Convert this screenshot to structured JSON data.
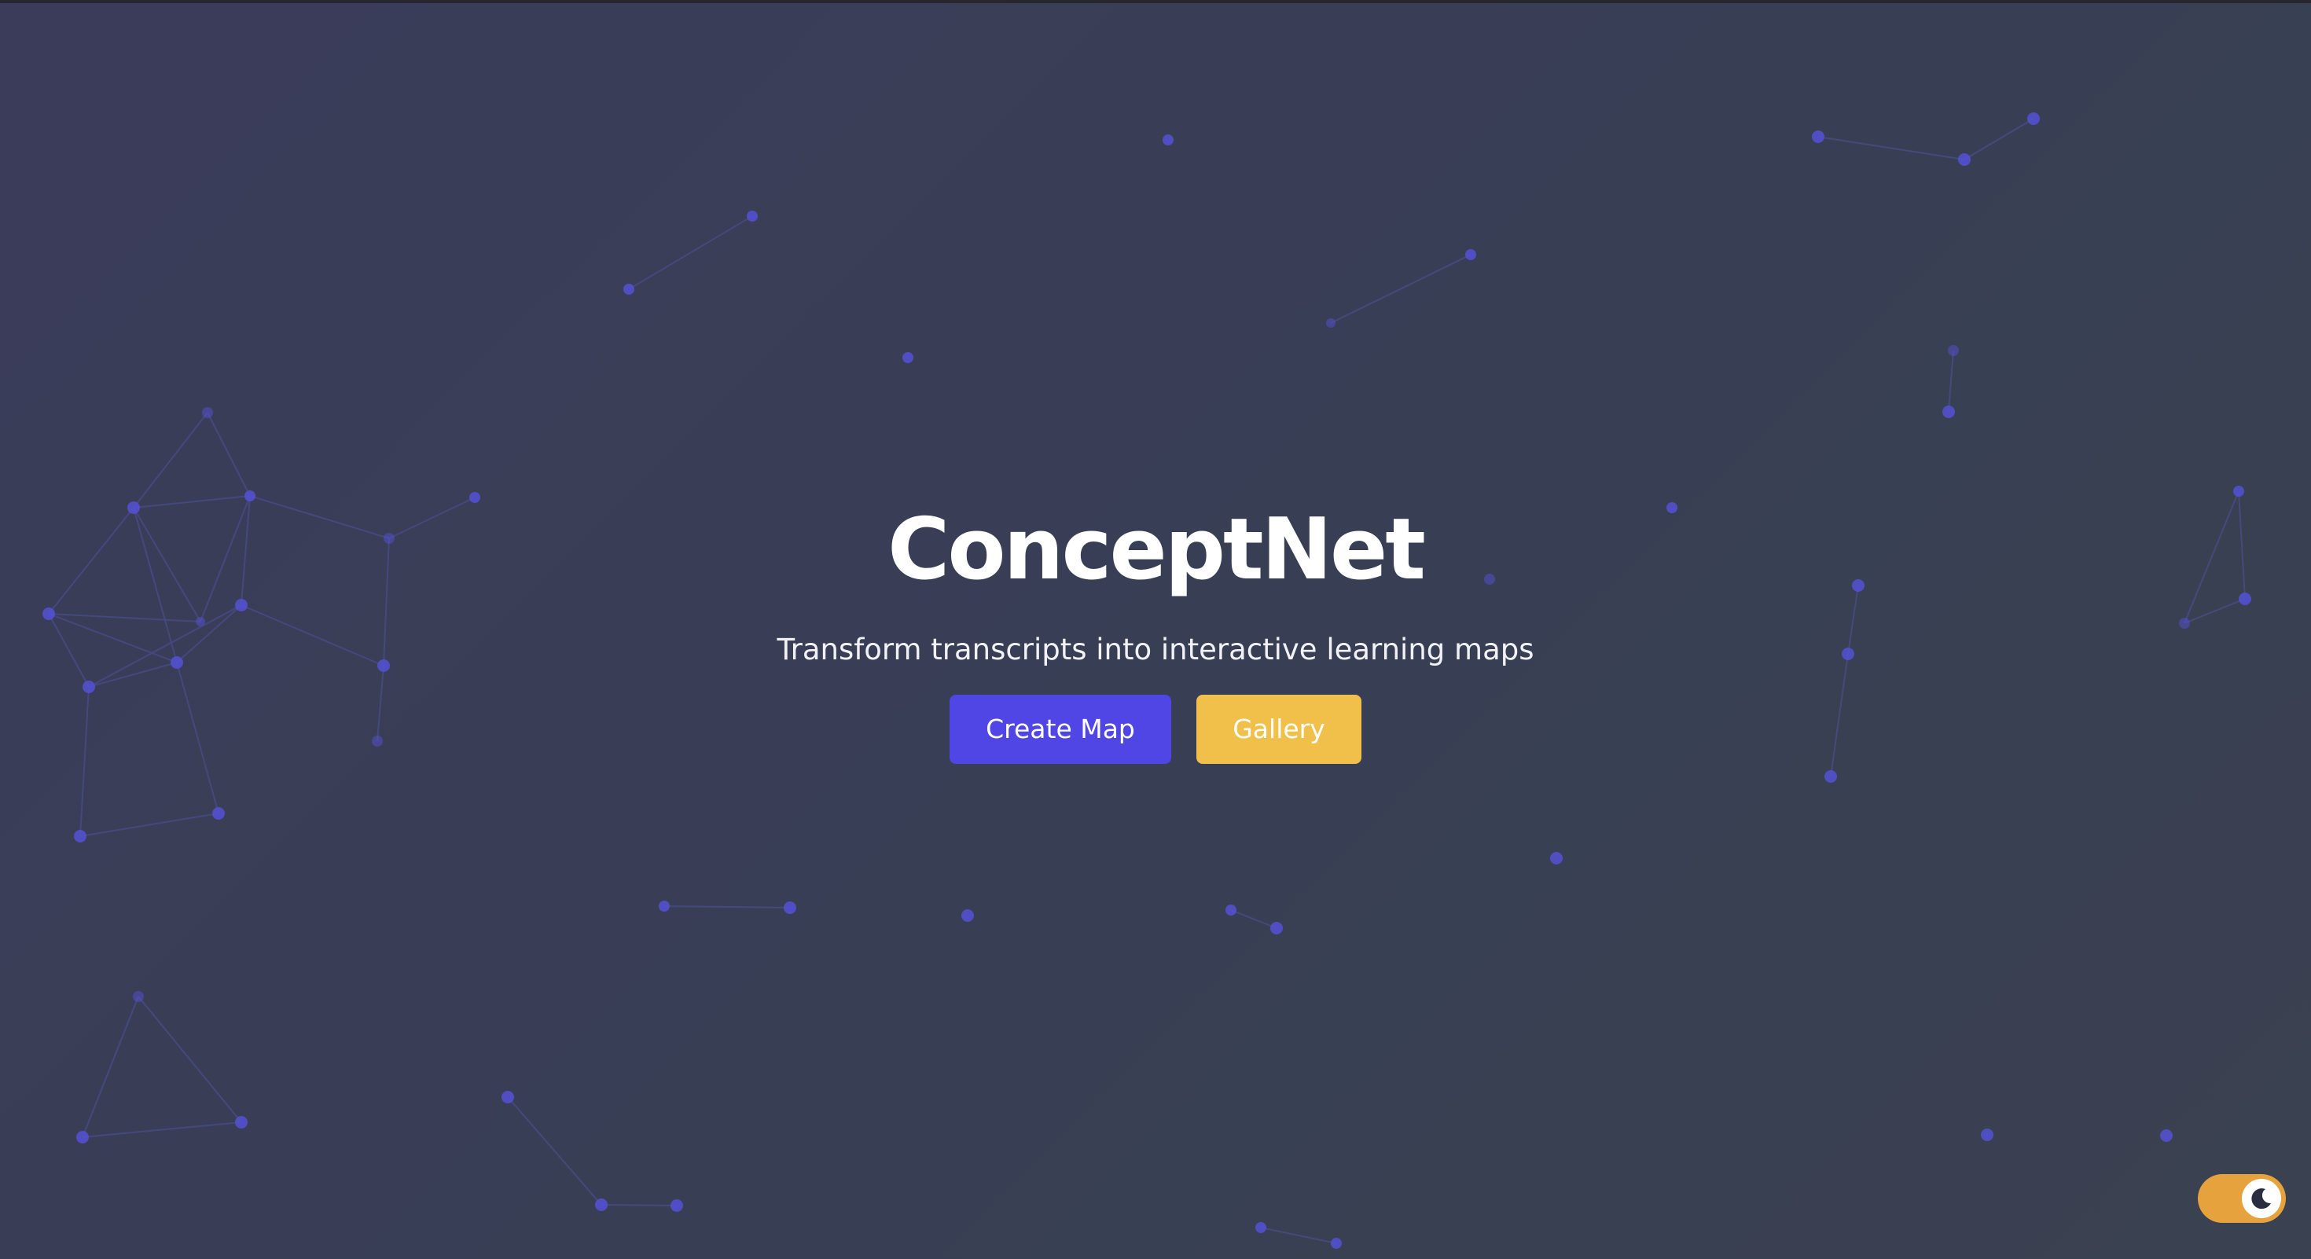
{
  "app": {
    "title": "ConceptNet",
    "tagline": "Transform transcripts into interactive learning maps"
  },
  "actions": {
    "create_label": "Create Map",
    "gallery_label": "Gallery"
  },
  "theme_toggle": {
    "icon": "moon-icon",
    "state": "dark"
  },
  "colors": {
    "primary": "#4f46e5",
    "secondary": "#f0c04a",
    "toggle": "#e6a23c",
    "node": "#5552d6"
  }
}
